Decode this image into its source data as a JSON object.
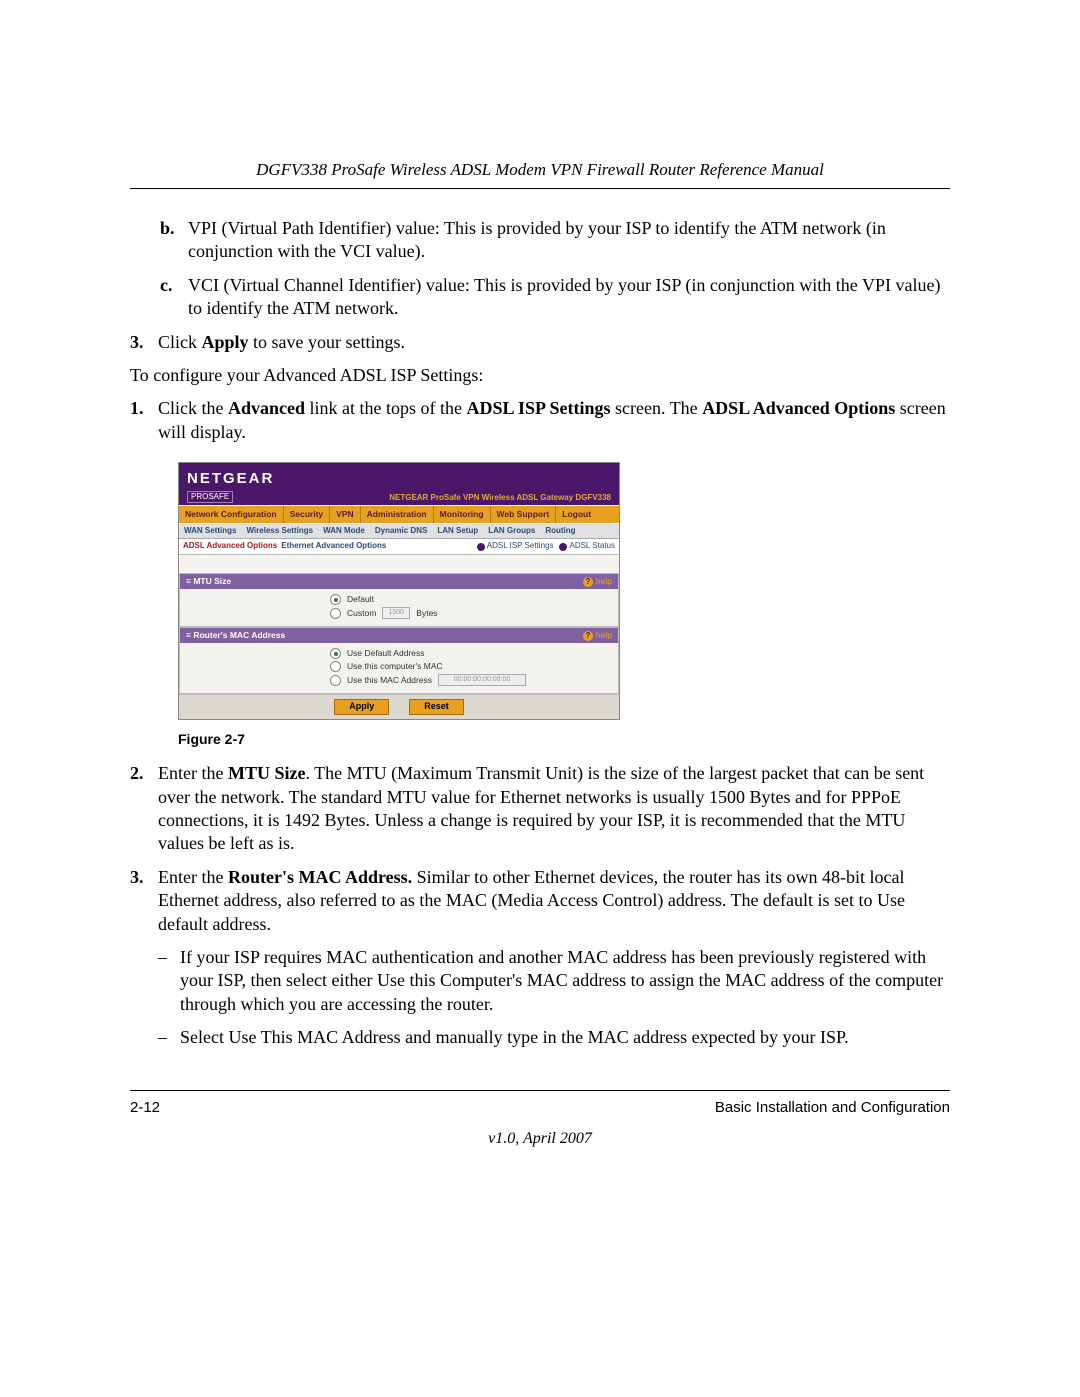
{
  "header": "DGFV338 ProSafe Wireless ADSL Modem VPN Firewall Router Reference Manual",
  "items": {
    "b_label": "b.",
    "b_text": "VPI (Virtual Path Identifier) value: This is provided by your ISP to identify the ATM network (in conjunction with the VCI value).",
    "c_label": "c.",
    "c_text": "VCI (Virtual Channel Identifier) value: This is provided by your ISP (in conjunction with the VPI value) to identify the ATM network.",
    "s3_label": "3.",
    "s3_pre": "Click ",
    "s3_bold": "Apply",
    "s3_post": " to save your settings.",
    "to_configure": "To configure your Advanced ADSL ISP Settings:",
    "a1_label": "1.",
    "a1_pre": "Click the ",
    "a1_b1": "Advanced",
    "a1_mid1": " link at the tops of the ",
    "a1_b2": "ADSL ISP Settings",
    "a1_mid2": " screen. The ",
    "a1_b3": "ADSL Advanced Options",
    "a1_post": " screen will display.",
    "fig_caption": "Figure 2-7",
    "a2_label": "2.",
    "a2_pre": "Enter the ",
    "a2_bold": "MTU Size",
    "a2_post": ". The MTU (Maximum Transmit Unit) is the size of the largest packet that can be sent over the network. The standard MTU value for Ethernet networks is usually 1500 Bytes and for PPPoE connections, it is 1492 Bytes. Unless a change is required by your ISP, it is recommended that the MTU values be left as is.",
    "a3_label": "3.",
    "a3_pre": "Enter the ",
    "a3_bold": "Router's MAC Address.",
    "a3_post": " Similar to other Ethernet devices, the router has its own 48-bit local Ethernet address, also referred to as the MAC (Media Access Control) address. The default is set to Use default address.",
    "dash1": "–",
    "bullet1": "If your ISP requires MAC authentication and another MAC address has been previously registered with your ISP, then select either Use this Computer's MAC address to assign the MAC address of the computer through which you are accessing the router.",
    "dash2": "–",
    "bullet2": "Select Use This MAC Address and manually type in the MAC address expected by your ISP."
  },
  "embed": {
    "logo": "NETGEAR",
    "sub": "PROSAFE",
    "product": "NETGEAR ProSafe VPN Wireless ADSL Gateway DGFV338",
    "nav1": [
      "Network Configuration",
      "Security",
      "VPN",
      "Administration",
      "Monitoring",
      "Web Support",
      "Logout"
    ],
    "nav2": [
      "WAN Settings",
      "Wireless Settings",
      "WAN Mode",
      "Dynamic DNS",
      "LAN Setup",
      "LAN Groups",
      "Routing"
    ],
    "nav3_left": [
      "ADSL Advanced Options",
      "Ethernet Advanced Options"
    ],
    "nav3_right": [
      "ADSL ISP Settings",
      "ADSL Status"
    ],
    "sec1_title": "MTU Size",
    "help": "help",
    "r_default": "Default",
    "r_custom": "Custom",
    "custom_val": "1500",
    "bytes": "Bytes",
    "sec2_title": "Router's MAC Address",
    "mac_default": "Use Default Address",
    "mac_pc": "Use this computer's MAC",
    "mac_this": "Use this MAC Address",
    "mac_val": "00:00:00:00:00:00",
    "btn_apply": "Apply",
    "btn_reset": "Reset"
  },
  "footer": {
    "page": "2-12",
    "section": "Basic Installation and Configuration",
    "version": "v1.0, April 2007"
  }
}
